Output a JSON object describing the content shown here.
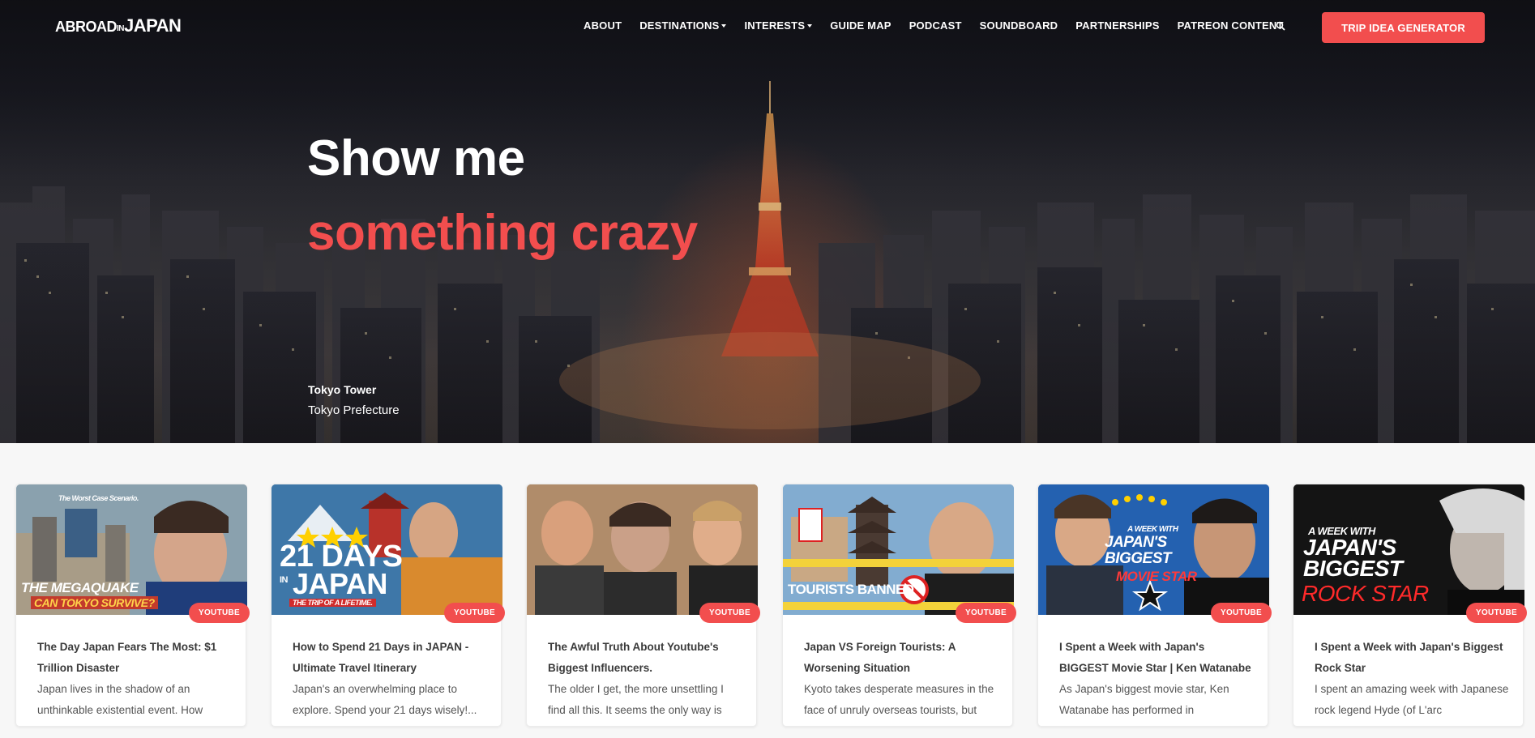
{
  "nav": {
    "logo": {
      "part1": "ABROAD",
      "part2": "IN",
      "part3": "JAPAN"
    },
    "links": [
      {
        "label": "ABOUT",
        "dropdown": false
      },
      {
        "label": "DESTINATIONS",
        "dropdown": true
      },
      {
        "label": "INTERESTS",
        "dropdown": true
      },
      {
        "label": "GUIDE MAP",
        "dropdown": false
      },
      {
        "label": "PODCAST",
        "dropdown": false
      },
      {
        "label": "SOUNDBOARD",
        "dropdown": false
      },
      {
        "label": "PARTNERSHIPS",
        "dropdown": false
      },
      {
        "label": "PATREON CONTENT",
        "dropdown": false
      }
    ],
    "search_icon": "search-icon",
    "cta_label": "TRIP IDEA GENERATOR"
  },
  "hero": {
    "line1": "Show me",
    "line2": "something crazy",
    "location_name": "Tokyo Tower",
    "location_prefecture": "Tokyo Prefecture"
  },
  "cards": [
    {
      "badge": "YOUTUBE",
      "title": "The Day Japan Fears The Most: $1 Trillion Disaster",
      "excerpt": "Japan lives in the shadow of an unthinkable existential event. How",
      "thumb_text": [
        "The Worst Case Scenario.",
        "THE MEGAQUAKE",
        "CAN TOKYO SURVIVE?"
      ]
    },
    {
      "badge": "YOUTUBE",
      "title": "How to Spend 21 Days in JAPAN - Ultimate Travel Itinerary",
      "excerpt": "Japan's an overwhelming place to explore. Spend your 21 days wisely!...",
      "thumb_text": [
        "21 DAYS",
        "IN",
        "JAPAN",
        "THE TRIP OF A LIFETIME."
      ]
    },
    {
      "badge": "YOUTUBE",
      "title": "The Awful Truth About Youtube's Biggest Influencers.",
      "excerpt": "The older I get, the more unsettling I find all this. It seems the only way is",
      "thumb_text": []
    },
    {
      "badge": "YOUTUBE",
      "title": "Japan VS Foreign Tourists: A Worsening Situation",
      "excerpt": "Kyoto takes desperate measures in the face of unruly overseas tourists, but",
      "thumb_text": [
        "TOURISTS BANNED"
      ]
    },
    {
      "badge": "YOUTUBE",
      "title": "I Spent a Week with Japan's BIGGEST Movie Star | Ken Watanabe",
      "excerpt": "As Japan's biggest movie star, Ken Watanabe has performed in",
      "thumb_text": [
        "A WEEK WITH",
        "JAPAN'S BIGGEST",
        "MOVIE STAR"
      ]
    },
    {
      "badge": "YOUTUBE",
      "title": "I Spent a Week with Japan's Biggest Rock Star",
      "excerpt": "I spent an amazing week with Japanese rock legend Hyde (of L'arc",
      "thumb_text": [
        "A WEEK WITH",
        "JAPAN'S",
        "BIGGEST",
        "ROCK STAR"
      ]
    }
  ],
  "colors": {
    "accent": "#f24e4e",
    "text_dark": "#3a3a3a",
    "hero_bg": "#1d1e26"
  }
}
